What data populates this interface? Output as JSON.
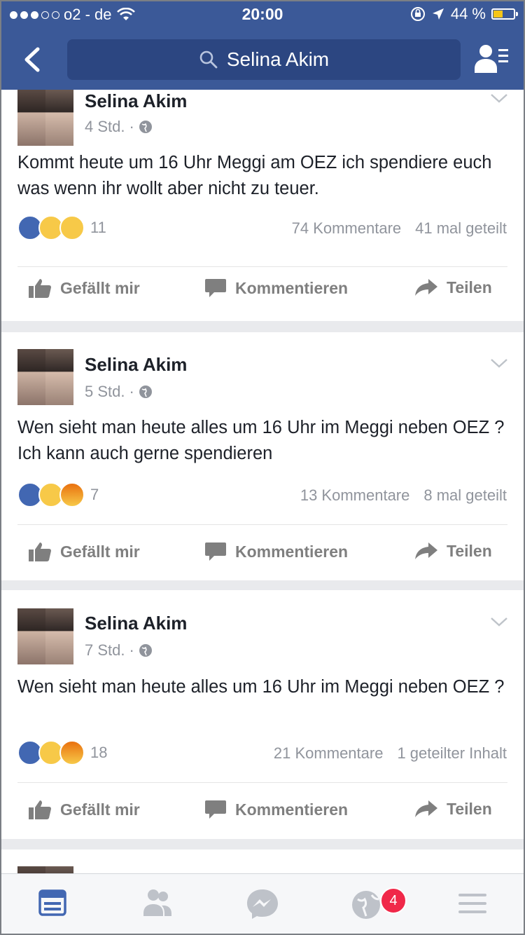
{
  "status_bar": {
    "carrier": "o2 - de",
    "time": "20:00",
    "battery": "44 %",
    "battery_level": 0.44
  },
  "nav": {
    "search_text": "Selina Akim"
  },
  "posts": [
    {
      "author": "Selina Akim",
      "time": "4 Std.",
      "text": "Kommt heute um 16 Uhr Meggi am OEZ ich spendiere euch was wenn ihr wollt aber nicht zu teuer.",
      "reactions": [
        "like",
        "wow",
        "sad"
      ],
      "reaction_count": "11",
      "comments": "74 Kommentare",
      "shares": "41 mal geteilt"
    },
    {
      "author": "Selina Akim",
      "time": "5 Std.",
      "text": "Wen sieht man heute alles um 16 Uhr im Meggi neben OEZ ? Ich kann auch gerne spendieren",
      "reactions": [
        "like",
        "wow",
        "angry"
      ],
      "reaction_count": "7",
      "comments": "13 Kommentare",
      "shares": "8 mal geteilt"
    },
    {
      "author": "Selina Akim",
      "time": "7 Std.",
      "text": "Wen sieht man heute alles um 16 Uhr im Meggi neben OEZ ?",
      "reactions": [
        "like",
        "wow",
        "angry"
      ],
      "reaction_count": "18",
      "comments": "21 Kommentare",
      "shares": "1 geteilter Inhalt"
    }
  ],
  "actions": {
    "like": "Gefällt mir",
    "comment": "Kommentieren",
    "share": "Teilen"
  },
  "tabbar": {
    "notifications_badge": "4",
    "icons": [
      "news-feed-icon",
      "friends-icon",
      "messenger-icon",
      "globe-icon",
      "menu-icon"
    ]
  },
  "colors": {
    "brand": "#3b5998",
    "active_tab": "#4267b2",
    "badge": "#f02849"
  }
}
